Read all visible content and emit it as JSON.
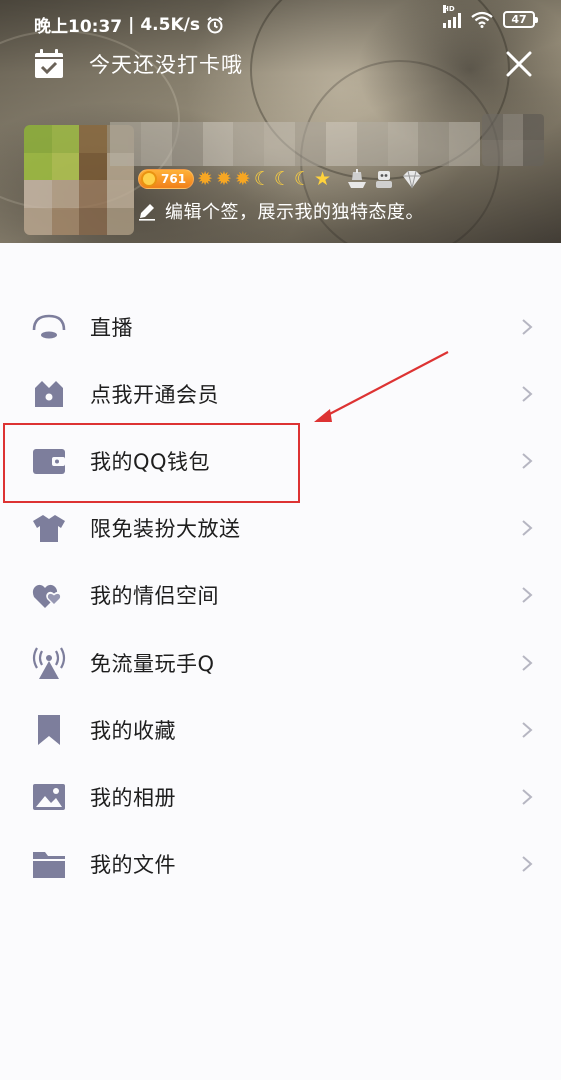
{
  "status_bar": {
    "time": "晚上10:37",
    "speed": "4.5K/s",
    "network_type": "HD",
    "battery": "47"
  },
  "header": {
    "checkin_text": "今天还没打卡哦",
    "level_number": "761",
    "signature": "编辑个签，展示我的独特态度。",
    "badges": [
      "sun",
      "sun",
      "sun",
      "moon",
      "moon",
      "moon",
      "star"
    ]
  },
  "menu": {
    "items": [
      {
        "label": "直播",
        "icon": "live-icon"
      },
      {
        "label": "点我开通会员",
        "icon": "vip-icon"
      },
      {
        "label": "我的QQ钱包",
        "icon": "wallet-icon"
      },
      {
        "label": "限免装扮大放送",
        "icon": "shirt-icon"
      },
      {
        "label": "我的情侣空间",
        "icon": "hearts-icon"
      },
      {
        "label": "免流量玩手Q",
        "icon": "antenna-icon"
      },
      {
        "label": "我的收藏",
        "icon": "bookmark-icon"
      },
      {
        "label": "我的相册",
        "icon": "album-icon"
      },
      {
        "label": "我的文件",
        "icon": "folder-icon"
      }
    ]
  },
  "colors": {
    "icon_color": "#7d7e9c",
    "highlight_color": "#dd3333"
  }
}
